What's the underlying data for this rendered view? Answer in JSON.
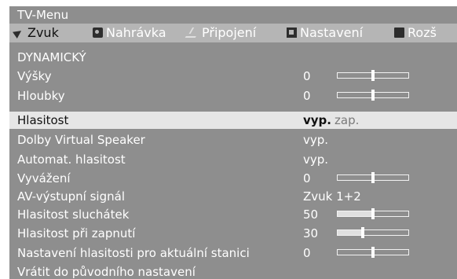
{
  "window": {
    "title": "TV-Menu"
  },
  "tabs": [
    {
      "label": "Zvuk",
      "icon": "speaker-icon",
      "active": true
    },
    {
      "label": "Nahrávka",
      "icon": "tape-icon",
      "active": false
    },
    {
      "label": "Připojení",
      "icon": "plug-icon",
      "active": false
    },
    {
      "label": "Nastavení",
      "icon": "settings-icon",
      "active": false
    },
    {
      "label": "Rozš",
      "icon": "tools-icon",
      "active": false
    }
  ],
  "menu": {
    "preset": "DYNAMICKÝ",
    "items": [
      {
        "label": "Výšky",
        "value": "0",
        "slider_level": 0.5
      },
      {
        "label": "Hloubky",
        "value": "0",
        "slider_level": 0.5
      },
      {
        "label": "Hlasitost",
        "value": "vyp.",
        "other": "zap.",
        "selected": true
      },
      {
        "label": "Dolby Virtual Speaker",
        "value": "vyp."
      },
      {
        "label": "Automat. hlasitost",
        "value": "vyp."
      },
      {
        "label": "Vyvážení",
        "value": "0",
        "slider_level": 0.5
      },
      {
        "label": "AV-výstupní signál",
        "value": "Zvuk 1+2"
      },
      {
        "label": "Hlasitost sluchátek",
        "value": "50",
        "slider_level": 0.5,
        "filled": true
      },
      {
        "label": "Hlasitost při zapnutí",
        "value": "30",
        "slider_level": 0.35,
        "filled": true
      },
      {
        "label": "Nastavení hlasitosti pro aktuální stanici",
        "value": "0",
        "slider_level": 0.5
      },
      {
        "label": "Vrátit do původního nastavení"
      }
    ]
  },
  "colors": {
    "panel": "#8e8e8e",
    "tabbar": "#b5b5b5",
    "selected_row": "#e6e6e6"
  }
}
